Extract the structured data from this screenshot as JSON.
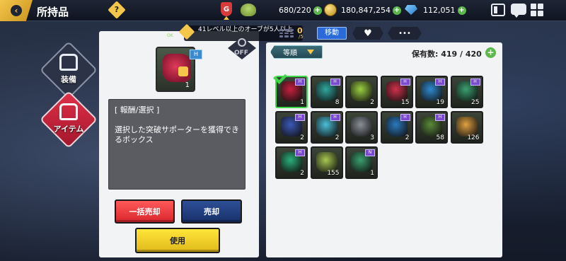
{
  "header": {
    "title": "所持品",
    "help_glyph": "?",
    "rank_badge": "G",
    "stamina": "680/220",
    "gold": "180,847,254",
    "gems": "112,051"
  },
  "sidebar": {
    "items": [
      {
        "label": "装備",
        "selected": false
      },
      {
        "label": "アイテム",
        "selected": true
      }
    ]
  },
  "detail": {
    "orb_tip": "41レベル以上のオーブが5人以上",
    "mini_badge": "OK",
    "lock_label": "OFF",
    "item_count": "1",
    "item_tag": "H",
    "desc_header": "[ 報酬/選択 ]",
    "desc_body": "選択した突破サポーターを獲得できるボックス",
    "bulk_sell_label": "一括売却",
    "sell_label": "売却",
    "use_label": "使用"
  },
  "inventory": {
    "tab_count": "0",
    "tab_count_sub": "/5",
    "move_label": "移動",
    "heart_glyph": "♥",
    "more_glyph": "•••",
    "sort_label": "等順",
    "owned_label": "保有数: 419 / 420",
    "add_glyph": "+",
    "items": [
      {
        "count": "1",
        "tag": "H",
        "color": "#c8203e",
        "selected": true
      },
      {
        "count": "8",
        "tag": "H",
        "color": "#2fa8a0"
      },
      {
        "count": "2",
        "tag": "",
        "color": "#9cd040"
      },
      {
        "count": "15",
        "tag": "H",
        "color": "#d0304a"
      },
      {
        "count": "19",
        "tag": "H",
        "color": "#2f8ad0"
      },
      {
        "count": "25",
        "tag": "H",
        "color": "#3aa070"
      },
      {
        "count": "2",
        "tag": "H",
        "color": "#3a5ab8"
      },
      {
        "count": "2",
        "tag": "H",
        "color": "#4ac0d8"
      },
      {
        "count": "3",
        "tag": "",
        "color": "#8a9098"
      },
      {
        "count": "2",
        "tag": "H",
        "color": "#2a7ac0"
      },
      {
        "count": "58",
        "tag": "H",
        "color": "#5a8a3a"
      },
      {
        "count": "126",
        "tag": "",
        "color": "#e0a040"
      },
      {
        "count": "2",
        "tag": "H",
        "color": "#2ab07a"
      },
      {
        "count": "155",
        "tag": "",
        "color": "#a8c850"
      },
      {
        "count": "1",
        "tag": "N",
        "color": "#3aa070"
      }
    ]
  },
  "colors": {
    "accent_gold": "#f4c64a",
    "sell_red": "#d9262c",
    "sell_blue": "#17306a",
    "use_yellow": "#ffe63a",
    "move_blue": "#2a6ad8"
  }
}
